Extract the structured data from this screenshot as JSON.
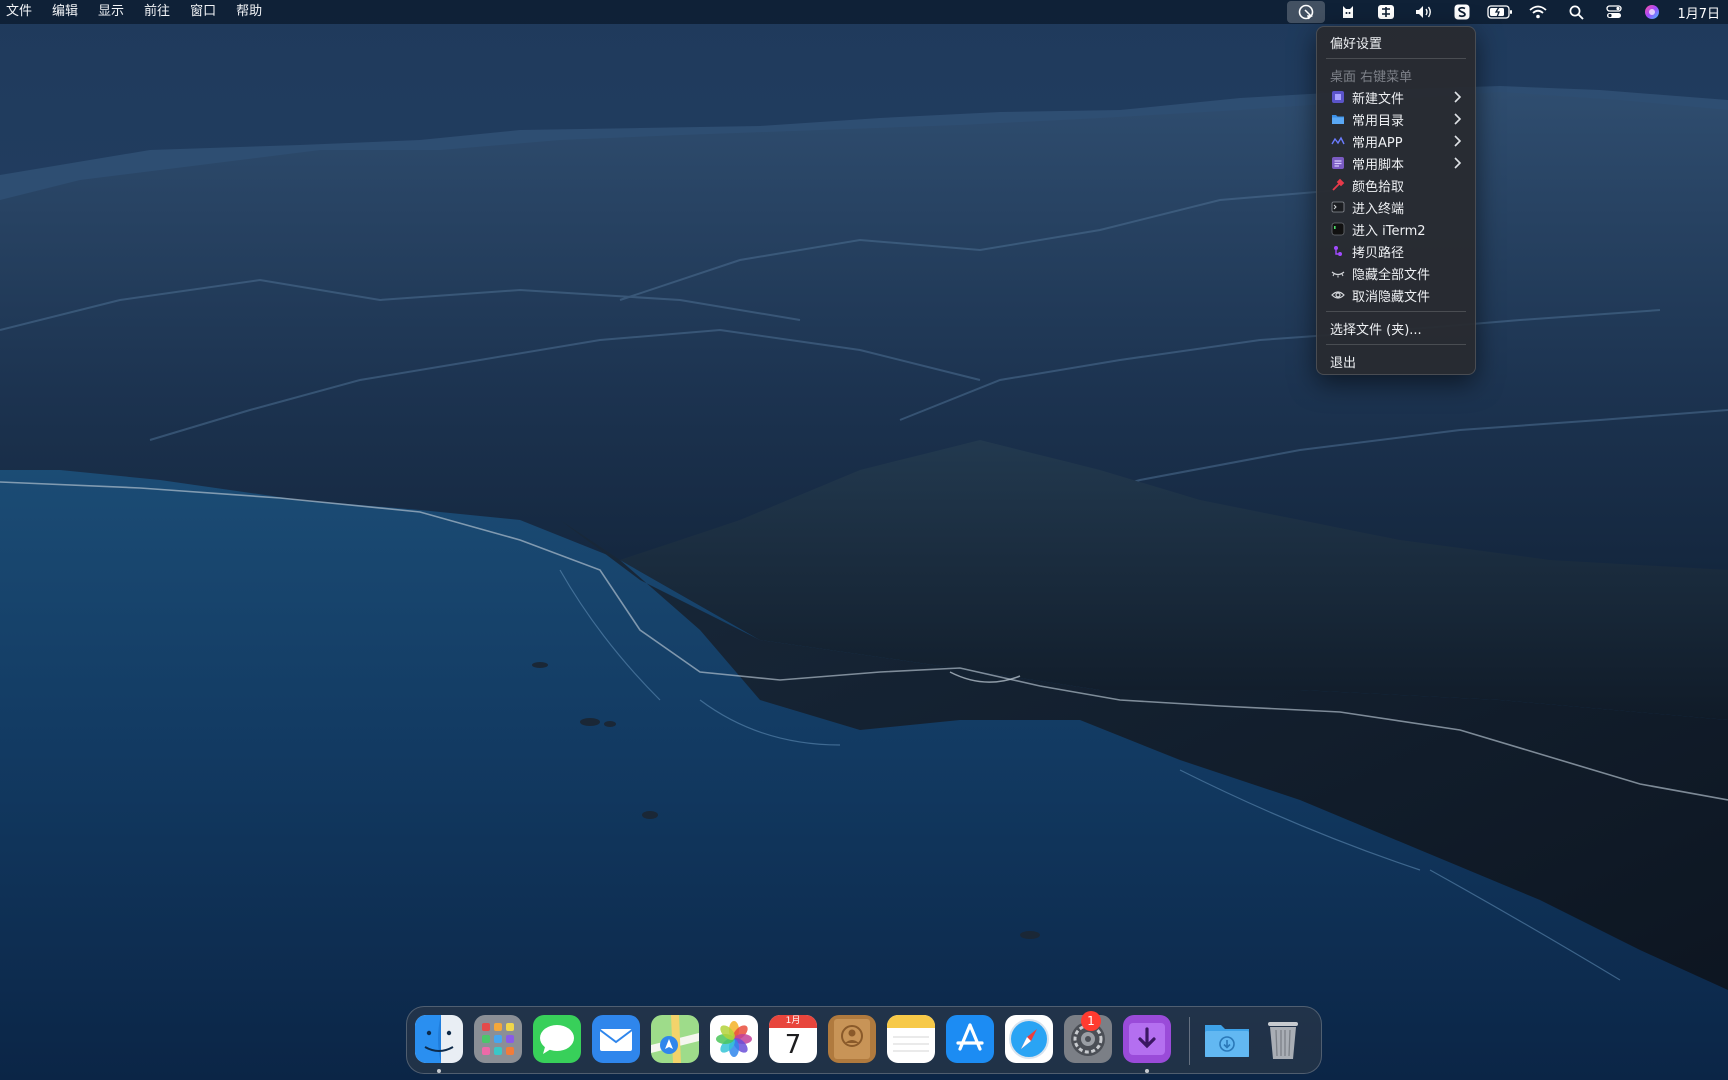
{
  "menubar": {
    "app_menus": [
      "文件",
      "编辑",
      "显示",
      "前往",
      "窗口",
      "帮助"
    ],
    "clock": "1月7日",
    "status_icons": [
      "cursor-app-icon",
      "cat-app-icon",
      "input-method-icon",
      "volume-icon",
      "s-app-icon",
      "battery-icon",
      "wifi-icon",
      "spotlight-search-icon",
      "control-center-icon",
      "siri-icon"
    ]
  },
  "dropdown": {
    "preferences": "偏好设置",
    "section_header": "桌面 右键菜单",
    "items": [
      {
        "label": "新建文件",
        "icon": "new-file-icon",
        "submenu": true
      },
      {
        "label": "常用目录",
        "icon": "folder-icon",
        "submenu": true
      },
      {
        "label": "常用APP",
        "icon": "app-icon",
        "submenu": true
      },
      {
        "label": "常用脚本",
        "icon": "script-icon",
        "submenu": true
      },
      {
        "label": "颜色拾取",
        "icon": "color-picker-icon",
        "submenu": false
      },
      {
        "label": "进入终端",
        "icon": "terminal-icon",
        "submenu": false
      },
      {
        "label": "进入 iTerm2",
        "icon": "iterm2-icon",
        "submenu": false
      },
      {
        "label": "拷贝路径",
        "icon": "copy-path-icon",
        "submenu": false
      },
      {
        "label": "隐藏全部文件",
        "icon": "eye-closed-icon",
        "submenu": false
      },
      {
        "label": "取消隐藏文件",
        "icon": "eye-open-icon",
        "submenu": false
      }
    ],
    "choose_file": "选择文件 (夹)...",
    "quit": "退出"
  },
  "dock": {
    "apps": [
      "finder-icon",
      "launchpad-icon",
      "messages-icon",
      "mail-icon",
      "maps-icon",
      "photos-icon",
      "calendar-icon",
      "contacts-icon",
      "notes-icon",
      "app-store-icon",
      "safari-icon",
      "system-preferences-icon",
      "downloader-icon"
    ],
    "folder": "downloads-folder-icon",
    "trash": "trash-icon",
    "calendar_month": "1月",
    "calendar_day": "7",
    "system_preferences_badge": "1"
  }
}
